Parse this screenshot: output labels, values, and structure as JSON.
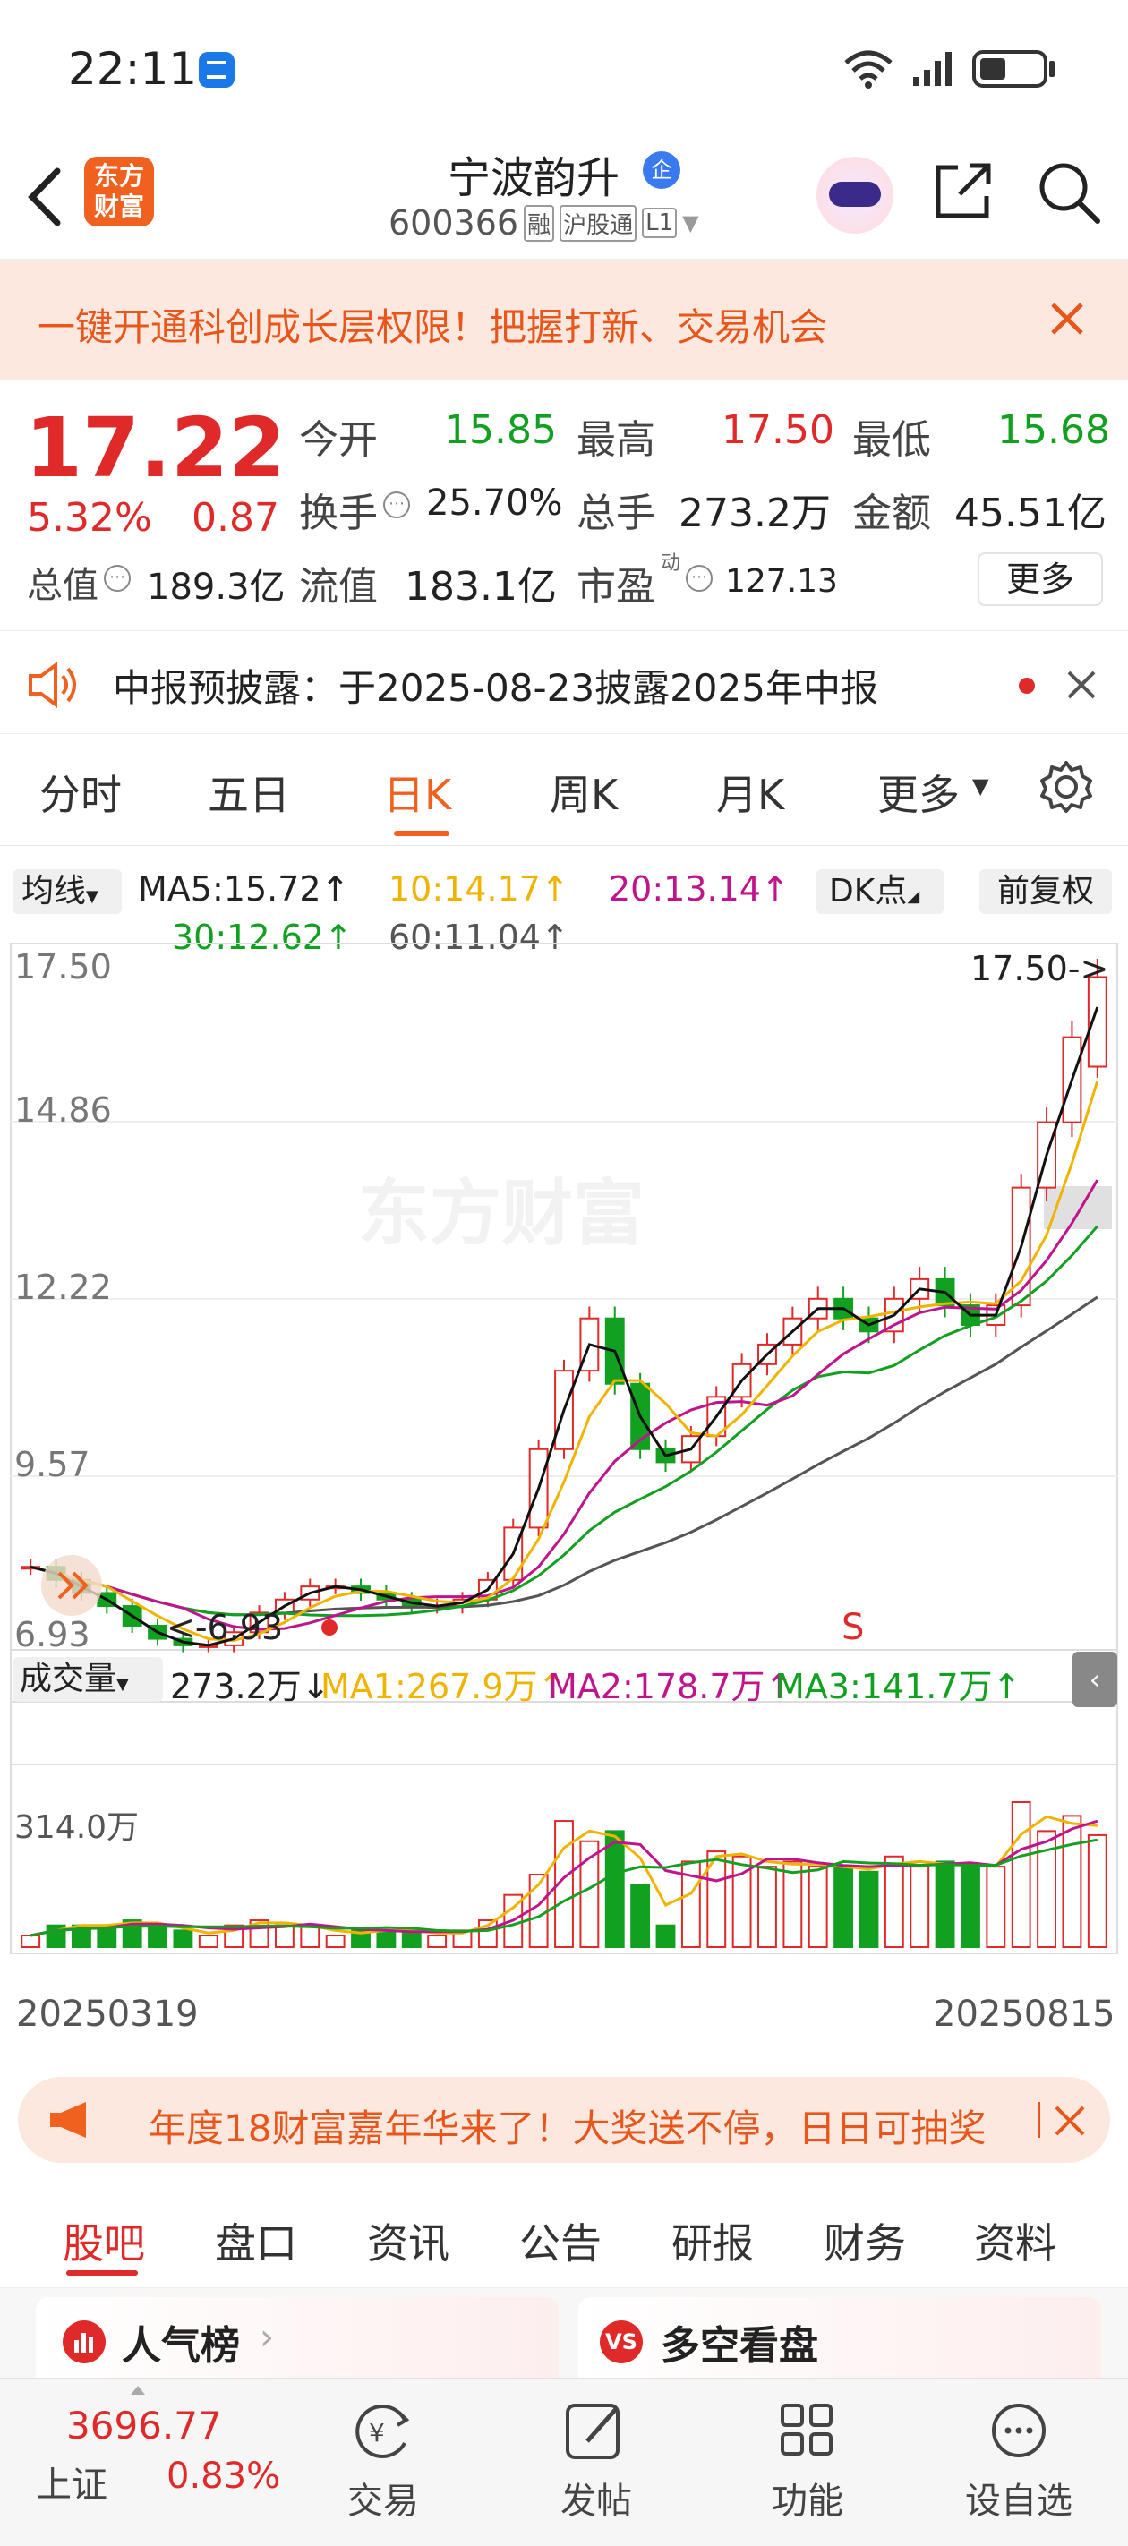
{
  "status_bar": {
    "time": "22:11"
  },
  "header": {
    "logo_line1": "东方",
    "logo_line2": "财富",
    "stock_name": "宁波韵升",
    "badge": "企",
    "stock_code": "600366",
    "tag1": "融",
    "tag2": "沪股通",
    "tag3": "L1"
  },
  "banner": {
    "text": "一键开通科创成长层权限！把握打新、交易机会"
  },
  "quote": {
    "price": "17.22",
    "change_pct": "5.32%",
    "change_abs": "0.87",
    "open_label": "今开",
    "open_value": "15.85",
    "high_label": "最高",
    "high_value": "17.50",
    "low_label": "最低",
    "low_value": "15.68",
    "turnover_label": "换手",
    "turnover_value": "25.70%",
    "volume_label": "总手",
    "volume_value": "273.2万",
    "amount_label": "金额",
    "amount_value": "45.51亿",
    "mktcap_label": "总值",
    "mktcap_value": "189.3亿",
    "float_label": "流值",
    "float_value": "183.1亿",
    "pe_label": "市盈",
    "pe_sup": "动",
    "pe_value": "127.13",
    "more_label": "更多"
  },
  "notice": {
    "text": "中报预披露：于2025-08-23披露2025年中报"
  },
  "chart_tabs": {
    "t1": "分时",
    "t2": "五日",
    "t3": "日K",
    "t4": "周K",
    "t5": "月K",
    "t6": "更多"
  },
  "ma_bar": {
    "selector": "均线",
    "ma5": "MA5:15.72↑",
    "ma10": "10:14.17↑",
    "ma20": "20:13.14↑",
    "ma30": "30:12.62↑",
    "ma60": "60:11.04↑",
    "dk": "DK点",
    "adjust": "前复权"
  },
  "price_axis": {
    "p1": "17.50",
    "p2": "14.86",
    "p3": "12.22",
    "p4": "9.57",
    "p5": "6.93"
  },
  "annotations": {
    "high": "17.50->",
    "low": "<-6.93",
    "s_marker": "S",
    "watermark": "东方财富"
  },
  "volume_bar": {
    "selector": "成交量",
    "vol": "273.2万↓",
    "ma1": "MA1:267.9万↑",
    "ma2": "MA2:178.7万↑",
    "ma3": "MA3:141.7万↑",
    "axis_max": "314.0万"
  },
  "date_axis": {
    "start": "20250319",
    "end": "20250815"
  },
  "promo": {
    "text": "年度18财富嘉年华来了！大奖送不停，日日可抽奖"
  },
  "bottom_tabs": {
    "t1": "股吧",
    "t2": "盘口",
    "t3": "资讯",
    "t4": "公告",
    "t5": "研报",
    "t6": "财务",
    "t7": "资料"
  },
  "cards": {
    "c1": "人气榜",
    "c2": "多空看盘"
  },
  "bottom_nav": {
    "index_value": "3696.77",
    "index_name": "上证",
    "index_pct": "0.83%",
    "n1": "交易",
    "n2": "发帖",
    "n3": "功能",
    "n4": "设自选"
  },
  "colors": {
    "up": "#e02a2a",
    "down": "#12a020",
    "accent": "#f0601e",
    "ma5": "#111111",
    "ma10": "#f0b400",
    "ma20": "#c0148c",
    "ma30": "#12a020",
    "ma60": "#555555"
  },
  "chart_data": {
    "type": "candlestick",
    "x_range": [
      "20250319",
      "20250815"
    ],
    "y_ticks": [
      17.5,
      14.86,
      12.22,
      9.57,
      6.93
    ],
    "ylim": [
      6.93,
      17.5
    ],
    "last": {
      "open": 15.85,
      "high": 17.5,
      "low": 15.68,
      "close": 17.22
    },
    "close_estimates": [
      8.2,
      8.0,
      7.8,
      7.6,
      7.3,
      7.1,
      7.0,
      7.0,
      7.2,
      7.5,
      7.7,
      7.9,
      7.9,
      7.8,
      7.7,
      7.6,
      7.6,
      7.7,
      8.0,
      8.8,
      10.0,
      11.2,
      12.0,
      11.0,
      10.0,
      9.8,
      10.2,
      10.8,
      11.3,
      11.6,
      12.0,
      12.3,
      12.0,
      11.8,
      12.3,
      12.6,
      12.2,
      11.9,
      12.2,
      14.0,
      15.0,
      16.3,
      17.22
    ],
    "volume_max": "314.0万"
  }
}
